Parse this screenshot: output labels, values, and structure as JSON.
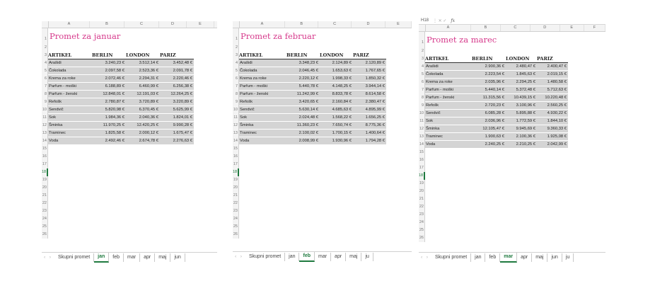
{
  "column_letters": [
    "A",
    "B",
    "C",
    "D",
    "E"
  ],
  "row_labels": [
    "ARTIKEL",
    "BERLIN",
    "LONDON",
    "PARIZ"
  ],
  "tabs_s1": [
    "Skupni promet",
    "jan",
    "feb",
    "mar",
    "apr",
    "maj",
    "jun"
  ],
  "tabs_s2": [
    "Skupni promet",
    "jan",
    "feb",
    "mar",
    "apr",
    "maj",
    "ju"
  ],
  "tabs_s3": [
    "Skupni promet",
    "jan",
    "feb",
    "mar",
    "apr",
    "maj",
    "jun",
    "ju"
  ],
  "s3_formula": {
    "namebox": "H18",
    "fx": "fx"
  },
  "sheets": [
    {
      "title": "Promet za januar",
      "active_tab": "jan",
      "items": [
        [
          "Arašidi",
          "3.240,23 €",
          "3.512,14 €",
          "3.452,48 €"
        ],
        [
          "Čokolada",
          "2.097,58 €",
          "2.523,36 €",
          "2.091,78 €"
        ],
        [
          "Krema za roke",
          "2.072,46 €",
          "2.294,31 €",
          "2.220,46 €"
        ],
        [
          "Parfum - moški",
          "6.188,89 €",
          "6.460,99 €",
          "6.256,38 €"
        ],
        [
          "Parfum - ženski",
          "12.848,01 €",
          "12.191,03 €",
          "12.264,25 €"
        ],
        [
          "Refošk",
          "2.780,87 €",
          "3.720,89 €",
          "3.220,89 €"
        ],
        [
          "Sendvič",
          "5.820,98 €",
          "6.370,45 €",
          "5.625,99 €"
        ],
        [
          "Sok",
          "1.984,36 €",
          "2.040,36 €",
          "1.824,01 €"
        ],
        [
          "Šminka",
          "11.970,25 €",
          "12.420,25 €",
          "9.990,28 €"
        ],
        [
          "Traminec",
          "1.825,58 €",
          "2.000,12 €",
          "1.675,47 €"
        ],
        [
          "Voda",
          "2.492,46 €",
          "2.674,78 €",
          "2.276,63 €"
        ]
      ]
    },
    {
      "title": "Promet za februar",
      "active_tab": "feb",
      "items": [
        [
          "Arašidi",
          "3.348,23 €",
          "2.124,89 €",
          "2.120,89 €"
        ],
        [
          "Čokolada",
          "2.046,45 €",
          "1.653,63 €",
          "1.767,65 €"
        ],
        [
          "Krema za roke",
          "2.220,12 €",
          "1.998,33 €",
          "1.850,32 €"
        ],
        [
          "Parfum - moški",
          "5.440,78 €",
          "4.148,25 €",
          "3.944,14 €"
        ],
        [
          "Parfum - ženski",
          "11.242,99 €",
          "8.833,78 €",
          "8.614,58 €"
        ],
        [
          "Refošk",
          "3.420,65 €",
          "2.160,84 €",
          "2.380,47 €"
        ],
        [
          "Sendvič",
          "5.630,14 €",
          "4.685,63 €",
          "4.895,99 €"
        ],
        [
          "Sok",
          "2.024,48 €",
          "1.568,22 €",
          "1.656,25 €"
        ],
        [
          "Šminka",
          "11.360,23 €",
          "7.650,74 €",
          "8.775,36 €"
        ],
        [
          "Traminec",
          "2.100,02 €",
          "1.700,15 €",
          "1.400,64 €"
        ],
        [
          "Voda",
          "2.008,99 €",
          "1.930,96 €",
          "1.794,28 €"
        ]
      ]
    },
    {
      "title": "Promet za marec",
      "active_tab": "mar",
      "items": [
        [
          "Arašidi",
          "2.900,36 €",
          "2.480,47 €",
          "2.400,47 €"
        ],
        [
          "Čokolada",
          "2.223,54 €",
          "1.845,63 €",
          "2.019,15 €"
        ],
        [
          "Krema za roke",
          "2.035,96 €",
          "2.294,25 €",
          "1.480,58 €"
        ],
        [
          "Parfum - moški",
          "5.440,14 €",
          "5.372,48 €",
          "5.712,63 €"
        ],
        [
          "Parfum - ženski",
          "11.315,56 €",
          "10.439,15 €",
          "10.220,48 €"
        ],
        [
          "Refošk",
          "2.720,23 €",
          "3.100,96 €",
          "2.560,25 €"
        ],
        [
          "Sendvič",
          "6.085,28 €",
          "5.895,88 €",
          "4.930,22 €"
        ],
        [
          "Sok",
          "2.036,96 €",
          "1.772,59 €",
          "1.844,10 €"
        ],
        [
          "Šminka",
          "12.105,47 €",
          "9.945,69 €",
          "9.360,33 €"
        ],
        [
          "Traminec",
          "1.900,63 €",
          "2.100,36 €",
          "1.925,08 €"
        ],
        [
          "Voda",
          "2.240,25 €",
          "2.210,25 €",
          "2.042,99 €"
        ]
      ]
    }
  ]
}
